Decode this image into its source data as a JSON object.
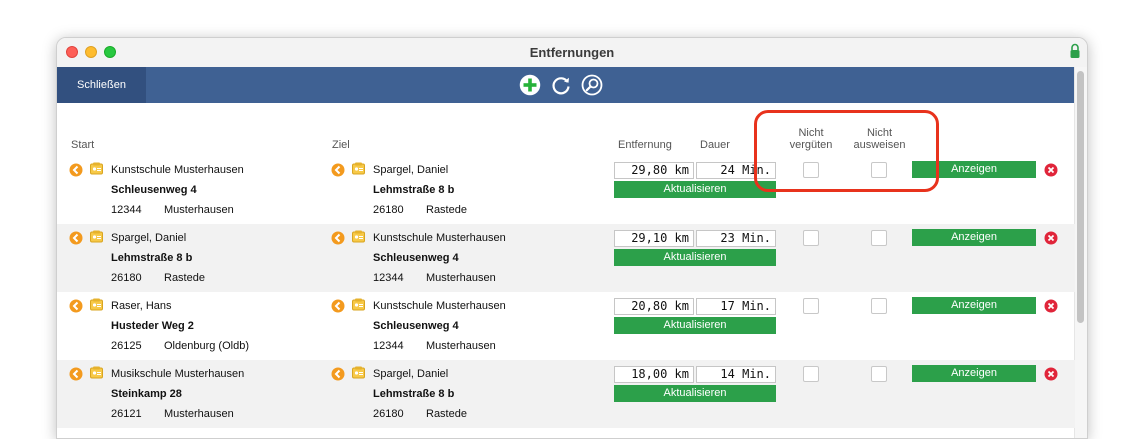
{
  "window": {
    "title": "Entfernungen"
  },
  "toolbar": {
    "close_label": "Schließen"
  },
  "columns": {
    "start": "Start",
    "ziel": "Ziel",
    "entfernung": "Entfernung",
    "dauer": "Dauer",
    "nicht_verguten_line1": "Nicht",
    "nicht_verguten_line2": "vergüten",
    "nicht_ausweisen_line1": "Nicht",
    "nicht_ausweisen_line2": "ausweisen"
  },
  "rows": [
    {
      "start": {
        "name": "Kunstschule Musterhausen",
        "street": "Schleusenweg 4",
        "zip": "12344",
        "city": "Musterhausen"
      },
      "ziel": {
        "name": "Spargel, Daniel",
        "street": "Lehmstraße 8 b",
        "zip": "26180",
        "city": "Rastede"
      },
      "distance": "29,80 km",
      "duration": "24 Min.",
      "update_label": "Aktualisieren",
      "show_label": "Anzeigen",
      "nicht_verguten": false,
      "nicht_ausweisen": false
    },
    {
      "start": {
        "name": "Spargel, Daniel",
        "street": "Lehmstraße 8 b",
        "zip": "26180",
        "city": "Rastede"
      },
      "ziel": {
        "name": "Kunstschule Musterhausen",
        "street": "Schleusenweg 4",
        "zip": "12344",
        "city": "Musterhausen"
      },
      "distance": "29,10 km",
      "duration": "23 Min.",
      "update_label": "Aktualisieren",
      "show_label": "Anzeigen",
      "nicht_verguten": false,
      "nicht_ausweisen": false
    },
    {
      "start": {
        "name": "Raser, Hans",
        "street": "Husteder Weg 2",
        "zip": "26125",
        "city": "Oldenburg (Oldb)"
      },
      "ziel": {
        "name": "Kunstschule Musterhausen",
        "street": "Schleusenweg 4",
        "zip": "12344",
        "city": "Musterhausen"
      },
      "distance": "20,80 km",
      "duration": "17 Min.",
      "update_label": "Aktualisieren",
      "show_label": "Anzeigen",
      "nicht_verguten": false,
      "nicht_ausweisen": false
    },
    {
      "start": {
        "name": "Musikschule Musterhausen",
        "street": "Steinkamp 28",
        "zip": "26121",
        "city": "Musterhausen"
      },
      "ziel": {
        "name": "Spargel, Daniel",
        "street": "Lehmstraße 8 b",
        "zip": "26180",
        "city": "Rastede"
      },
      "distance": "18,00 km",
      "duration": "14 Min.",
      "update_label": "Aktualisieren",
      "show_label": "Anzeigen",
      "nicht_verguten": false,
      "nicht_ausweisen": false
    }
  ],
  "icons": {
    "add": "plus-circle-icon",
    "refresh": "refresh-icon",
    "search": "search-icon",
    "lock": "lock-icon",
    "arrow": "arrow-left-icon",
    "card": "address-card-icon",
    "delete": "delete-icon"
  },
  "colors": {
    "toolbar": "#3f6193",
    "close_button": "#32507f",
    "green_button": "#2ca04a",
    "delete": "#e0253a",
    "arrow": "#f39a1e",
    "highlight": "#e8321c"
  }
}
